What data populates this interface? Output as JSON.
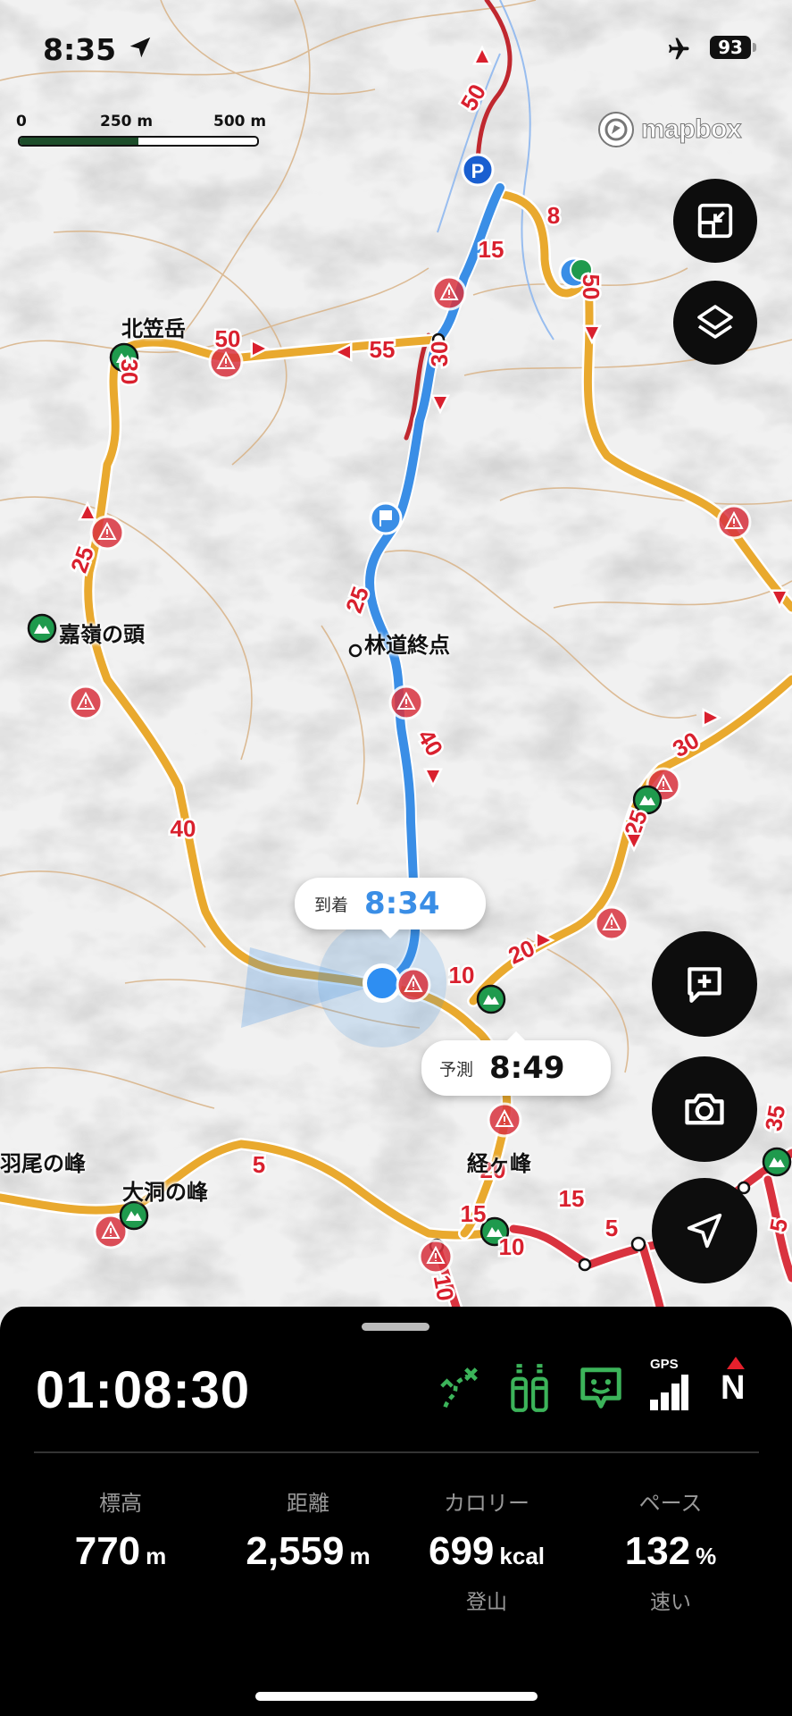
{
  "status_bar": {
    "time": "8:35",
    "battery": "93"
  },
  "map": {
    "attribution": "mapbox",
    "scale": {
      "labels": [
        "0",
        "250 m",
        "500 m"
      ]
    },
    "place_labels": [
      "北笠岳",
      "嘉嶺の頭",
      "林道終点",
      "羽尾の峰",
      "大洞の峰",
      "経ヶ峰"
    ],
    "time_labels": [
      "50",
      "8",
      "15",
      "50",
      "50",
      "55",
      "30",
      "30",
      "25",
      "25",
      "40",
      "40",
      "30",
      "25",
      "20",
      "10",
      "20",
      "5",
      "15",
      "15",
      "5",
      "10",
      "10",
      "5",
      "35"
    ],
    "arrival_bubble": {
      "label": "到着",
      "time": "8:34"
    },
    "forecast_bubble": {
      "label": "予測",
      "time": "8:49"
    },
    "colors": {
      "route_blue": "#3a8ee6",
      "trail_orange": "#e9a92e",
      "warning_red": "#d9333f",
      "peak_green": "#1f9a4d"
    }
  },
  "buttons": {
    "fit_route": "fit-route-icon",
    "layers": "layers-icon",
    "add_memo": "add-memo-icon",
    "camera": "camera-icon",
    "current_location": "location-arrow-icon"
  },
  "panel": {
    "elapsed": "01:08:30",
    "icons": [
      "route-progress-icon",
      "supplies-icon",
      "safety-chat-icon",
      "gps-signal-icon",
      "compass-north-icon"
    ],
    "gps_label": "GPS",
    "north_label": "N",
    "stats": [
      {
        "label": "標高",
        "value": "770",
        "unit": "m",
        "sub": ""
      },
      {
        "label": "距離",
        "value": "2,559",
        "unit": "m",
        "sub": ""
      },
      {
        "label": "カロリー",
        "value": "699",
        "unit": "kcal",
        "sub": "登山"
      },
      {
        "label": "ペース",
        "value": "132",
        "unit": "%",
        "sub": "速い"
      }
    ]
  }
}
